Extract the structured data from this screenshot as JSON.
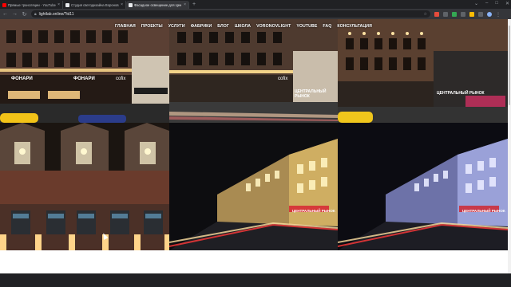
{
  "browser": {
    "tabs": [
      {
        "title": "Прямые трансляции - YouTube",
        "favicon_color": "#ff0000",
        "active": false
      },
      {
        "title": "Студия светодизайна Воронов",
        "favicon_color": "#e8eaed",
        "active": false
      },
      {
        "title": "Фасадное освещение для Цен",
        "favicon_color": "#e8eaed",
        "active": true
      }
    ],
    "new_tab_label": "+",
    "url": "lightlab.online/?id11"
  },
  "site_menu": {
    "items": [
      "ГЛАВНАЯ",
      "ПРОЕКТЫ",
      "УСЛУГИ",
      "ФАБРИКИ",
      "БЛОГ",
      "ШКОЛА",
      "VORONOVLIGHT",
      "YOUTUBE",
      "FAQ",
      "КОНСУЛЬТАЦИЯ"
    ]
  },
  "gallery": {
    "labels": {
      "shop_sign": "ЦЕНТРАЛЬНЫЙ РЫНОК",
      "brand": "ФОНАРИ",
      "cofix": "cofix"
    }
  }
}
